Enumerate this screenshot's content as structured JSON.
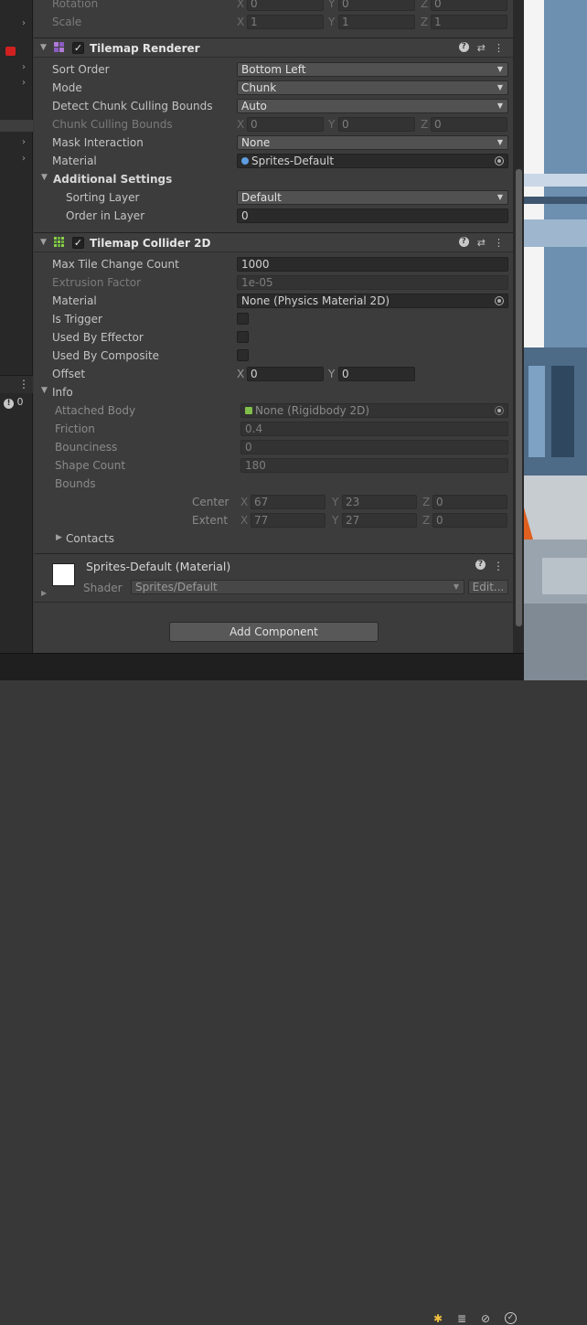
{
  "transform": {
    "rotation": {
      "label": "Rotation",
      "x": "0",
      "y": "0",
      "z": "0"
    },
    "scale": {
      "label": "Scale",
      "x": "1",
      "y": "1",
      "z": "1"
    }
  },
  "tilemap_renderer": {
    "title": "Tilemap Renderer",
    "enabled": "✓",
    "sort_order": {
      "label": "Sort Order",
      "value": "Bottom Left"
    },
    "mode": {
      "label": "Mode",
      "value": "Chunk"
    },
    "detect_chunk_culling": {
      "label": "Detect Chunk Culling Bounds",
      "value": "Auto"
    },
    "chunk_culling": {
      "label": "Chunk Culling Bounds",
      "x": "0",
      "y": "0",
      "z": "0"
    },
    "mask_interaction": {
      "label": "Mask Interaction",
      "value": "None"
    },
    "material": {
      "label": "Material",
      "value": "Sprites-Default"
    },
    "additional_settings": {
      "label": "Additional Settings"
    },
    "sorting_layer": {
      "label": "Sorting Layer",
      "value": "Default"
    },
    "order_in_layer": {
      "label": "Order in Layer",
      "value": "0"
    }
  },
  "tilemap_collider": {
    "title": "Tilemap Collider 2D",
    "enabled": "✓",
    "max_tile_change": {
      "label": "Max Tile Change Count",
      "value": "1000"
    },
    "extrusion": {
      "label": "Extrusion Factor",
      "value": "1e-05"
    },
    "material": {
      "label": "Material",
      "value": "None (Physics Material 2D)"
    },
    "is_trigger": {
      "label": "Is Trigger"
    },
    "used_by_effector": {
      "label": "Used By Effector"
    },
    "used_by_composite": {
      "label": "Used By Composite"
    },
    "offset": {
      "label": "Offset",
      "x": "0",
      "y": "0"
    },
    "info": {
      "label": "Info",
      "attached_body": {
        "label": "Attached Body",
        "value": "None (Rigidbody 2D)"
      },
      "friction": {
        "label": "Friction",
        "value": "0.4"
      },
      "bounciness": {
        "label": "Bounciness",
        "value": "0"
      },
      "shape_count": {
        "label": "Shape Count",
        "value": "180"
      },
      "bounds": {
        "label": "Bounds"
      },
      "center": {
        "label": "Center",
        "x": "67",
        "y": "23",
        "z": "0"
      },
      "extent": {
        "label": "Extent",
        "x": "77",
        "y": "27",
        "z": "0"
      },
      "contacts": {
        "label": "Contacts"
      }
    }
  },
  "material_preview": {
    "name": "Sprites-Default (Material)",
    "shader_label": "Shader",
    "shader": "Sprites/Default",
    "edit": "Edit..."
  },
  "add_component": "Add Component",
  "left_panel": {
    "badge": "0"
  },
  "axes": {
    "x": "X",
    "y": "Y",
    "z": "Z"
  },
  "colors": {
    "accent": "#5e9ee0",
    "panel": "#3c3c3c",
    "field": "#2a2a2a"
  }
}
